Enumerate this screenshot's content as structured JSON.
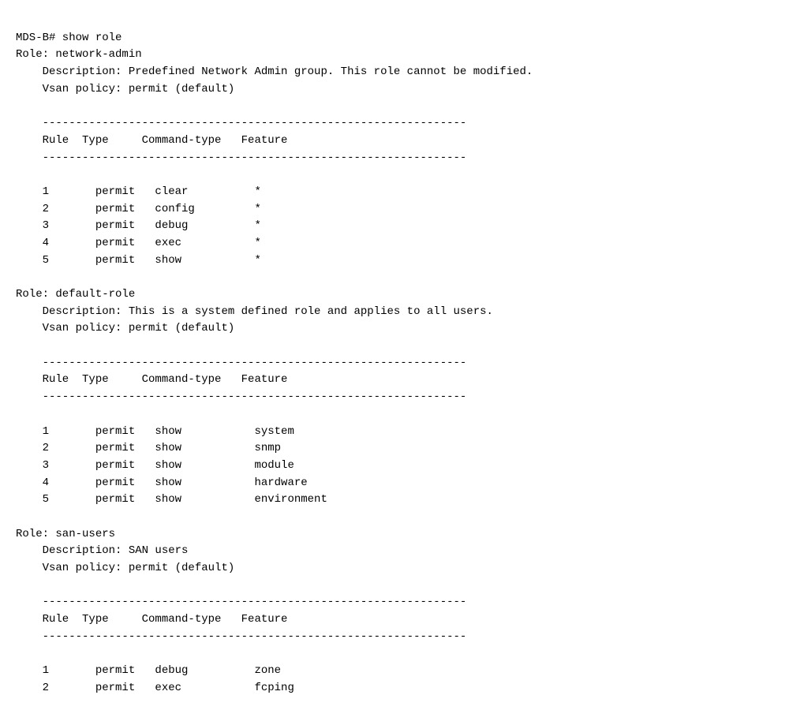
{
  "terminal": {
    "lines": [
      "MDS-B# show role",
      "Role: network-admin",
      "    Description: Predefined Network Admin group. This role cannot be modified.",
      "    Vsan policy: permit (default)",
      "",
      "    ----------------------------------------------------------------",
      "    Rule  Type     Command-type   Feature",
      "    ----------------------------------------------------------------",
      "",
      "    1       permit   clear          *",
      "    2       permit   config         *",
      "    3       permit   debug          *",
      "    4       permit   exec           *",
      "    5       permit   show           *",
      "",
      "Role: default-role",
      "    Description: This is a system defined role and applies to all users.",
      "    Vsan policy: permit (default)",
      "",
      "    ----------------------------------------------------------------",
      "    Rule  Type     Command-type   Feature",
      "    ----------------------------------------------------------------",
      "",
      "    1       permit   show           system",
      "    2       permit   show           snmp",
      "    3       permit   show           module",
      "    4       permit   show           hardware",
      "    5       permit   show           environment",
      "",
      "Role: san-users",
      "    Description: SAN users",
      "    Vsan policy: permit (default)",
      "",
      "    ----------------------------------------------------------------",
      "    Rule  Type     Command-type   Feature",
      "    ----------------------------------------------------------------",
      "",
      "    1       permit   debug          zone",
      "    2       permit   exec           fcping"
    ]
  }
}
